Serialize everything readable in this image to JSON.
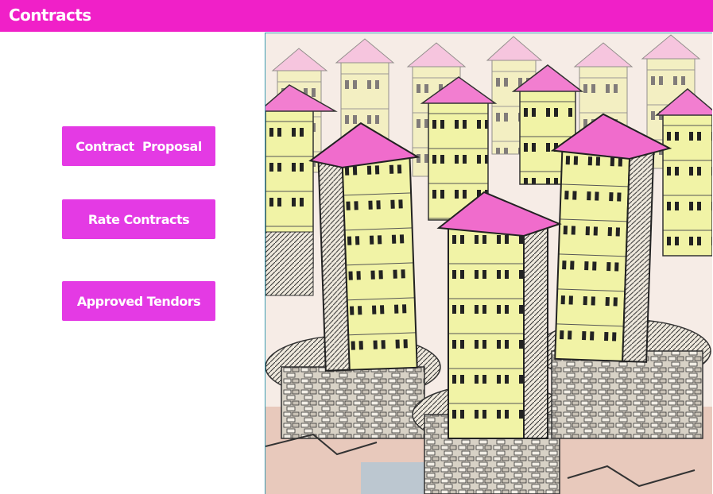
{
  "header": {
    "title": "Contracts"
  },
  "menu": {
    "buttons": [
      {
        "label": "Contract  Proposal"
      },
      {
        "label": "Rate Contracts"
      },
      {
        "label": "Approved Tendors"
      }
    ]
  },
  "colors": {
    "header_bg": "#f020c8",
    "button_bg": "#e43ae4",
    "button_text": "#ffffff"
  },
  "illustration": {
    "icon": "buildings-cartoon-illustration"
  }
}
